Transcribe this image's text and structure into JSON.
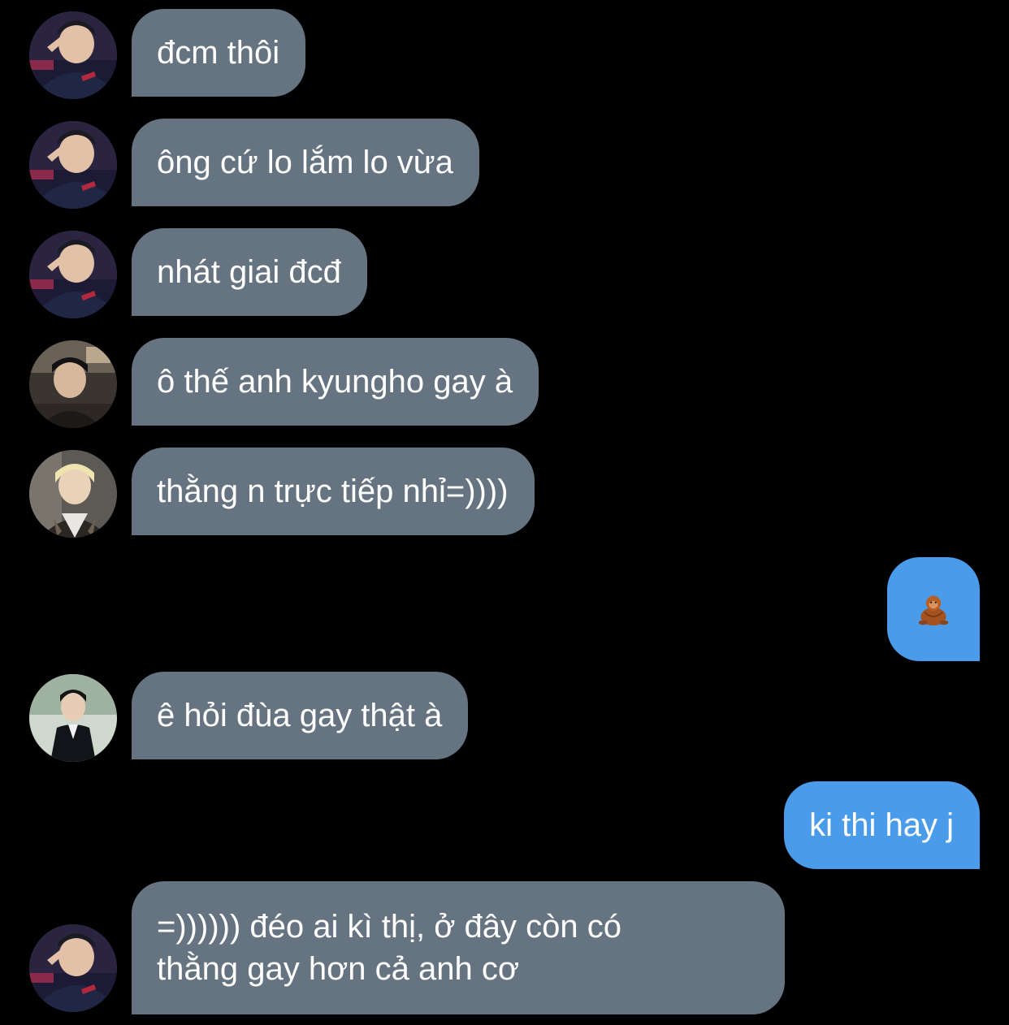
{
  "conversation": {
    "messages": [
      {
        "direction": "incoming",
        "sender_avatar": "avatar-player-salute",
        "text": "đcm thôi"
      },
      {
        "direction": "incoming",
        "sender_avatar": "avatar-player-salute",
        "text": "ông cứ lo lắm lo vừa"
      },
      {
        "direction": "incoming",
        "sender_avatar": "avatar-player-salute",
        "text": "nhát giai đcđ"
      },
      {
        "direction": "incoming",
        "sender_avatar": "avatar-player-dark-room",
        "text": "ô thế anh kyungho gay à"
      },
      {
        "direction": "incoming",
        "sender_avatar": "avatar-player-blond",
        "text": "thằng n trực tiếp nhỉ=))))"
      },
      {
        "direction": "outgoing",
        "emoji": "🦧",
        "emoji_name": "orangutan-emoji"
      },
      {
        "direction": "incoming",
        "sender_avatar": "avatar-player-suit",
        "text": "ê hỏi đùa gay thật à"
      },
      {
        "direction": "outgoing",
        "text": "ki thi hay j"
      },
      {
        "direction": "incoming",
        "sender_avatar": "avatar-player-salute",
        "text_lines": [
          "=)))))) đéo ai kì thị, ở đây còn có",
          "thằng gay hơn cả anh cơ"
        ]
      }
    ]
  },
  "colors": {
    "background": "#000000",
    "incoming_bubble": "#667380",
    "outgoing_bubble": "#4a9be9",
    "text": "#ffffff"
  }
}
